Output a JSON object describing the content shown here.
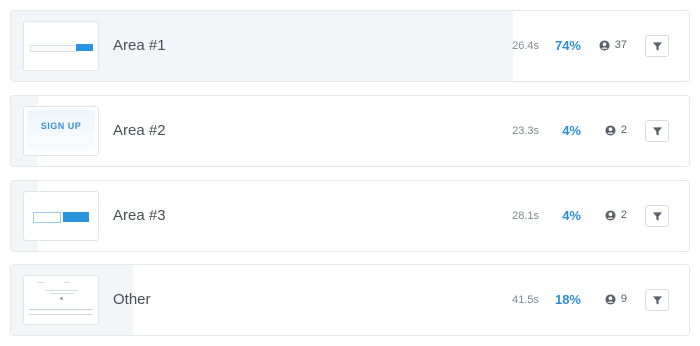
{
  "rows": [
    {
      "name": "Area #1",
      "time": "26.4s",
      "percent": "74%",
      "users": "37",
      "fill": 0.74,
      "thumbnail": "form-input-with-button"
    },
    {
      "name": "Area #2",
      "time": "23.3s",
      "percent": "4%",
      "users": "2",
      "fill": 0.04,
      "thumbnail_text": "SIGN UP"
    },
    {
      "name": "Area #3",
      "time": "28.1s",
      "percent": "4%",
      "users": "2",
      "fill": 0.04,
      "thumbnail": "two-buttons"
    },
    {
      "name": "Other",
      "time": "41.5s",
      "percent": "18%",
      "users": "9",
      "fill": 0.18,
      "thumbnail": "full-page"
    }
  ],
  "icons": {
    "users": "user-circle-icon",
    "filter": "filter-icon"
  },
  "colors": {
    "accent": "#2a8fd6",
    "fill": "#f3f5f8"
  }
}
